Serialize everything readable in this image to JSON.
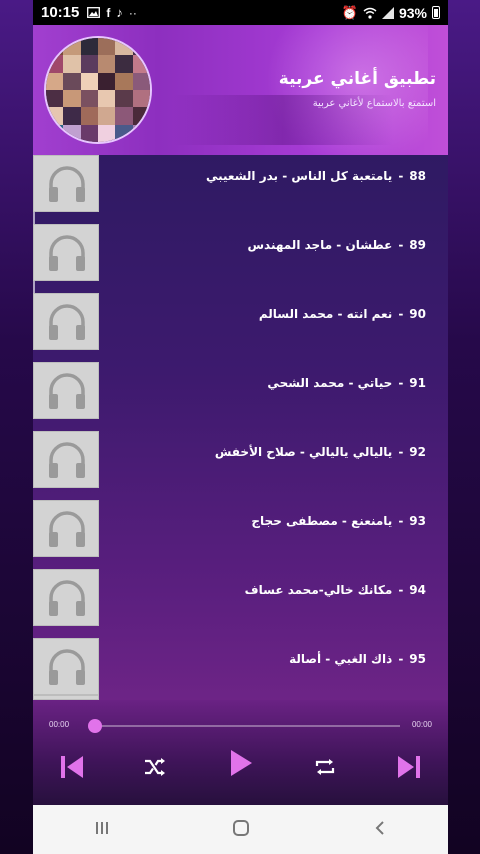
{
  "status_bar": {
    "time": "10:15",
    "battery": "93%"
  },
  "header": {
    "title": "تطبيق أغاني عربية",
    "subtitle": "استمتع بالاستماع لأغاني عربية",
    "accent": "#a13fcf"
  },
  "songs": [
    {
      "num": "88",
      "title": "يامتعبة كل الناس - بدر الشعيبي"
    },
    {
      "num": "89",
      "title": "عطشان - ماجد المهندس"
    },
    {
      "num": "90",
      "title": "نعم انته - محمد السالم"
    },
    {
      "num": "91",
      "title": "حياتي - محمد الشحي"
    },
    {
      "num": "92",
      "title": "ياليالي ياليالي - صلاح الأخفش"
    },
    {
      "num": "93",
      "title": "يامنعنع - مصطفى حجاج"
    },
    {
      "num": "94",
      "title": "مكانك خالي-محمد عساف"
    },
    {
      "num": "95",
      "title": "ذاك الغبي - أصالة"
    }
  ],
  "player": {
    "time_elapsed": "00:00",
    "time_total": "00:00",
    "progress": 0,
    "accent": "#e173ea",
    "controls": [
      "previous-icon",
      "shuffle-icon",
      "play-icon",
      "repeat-icon",
      "next-icon"
    ]
  },
  "nav_bar": {
    "icons": [
      "recent-apps-icon",
      "home-icon",
      "back-icon"
    ]
  }
}
